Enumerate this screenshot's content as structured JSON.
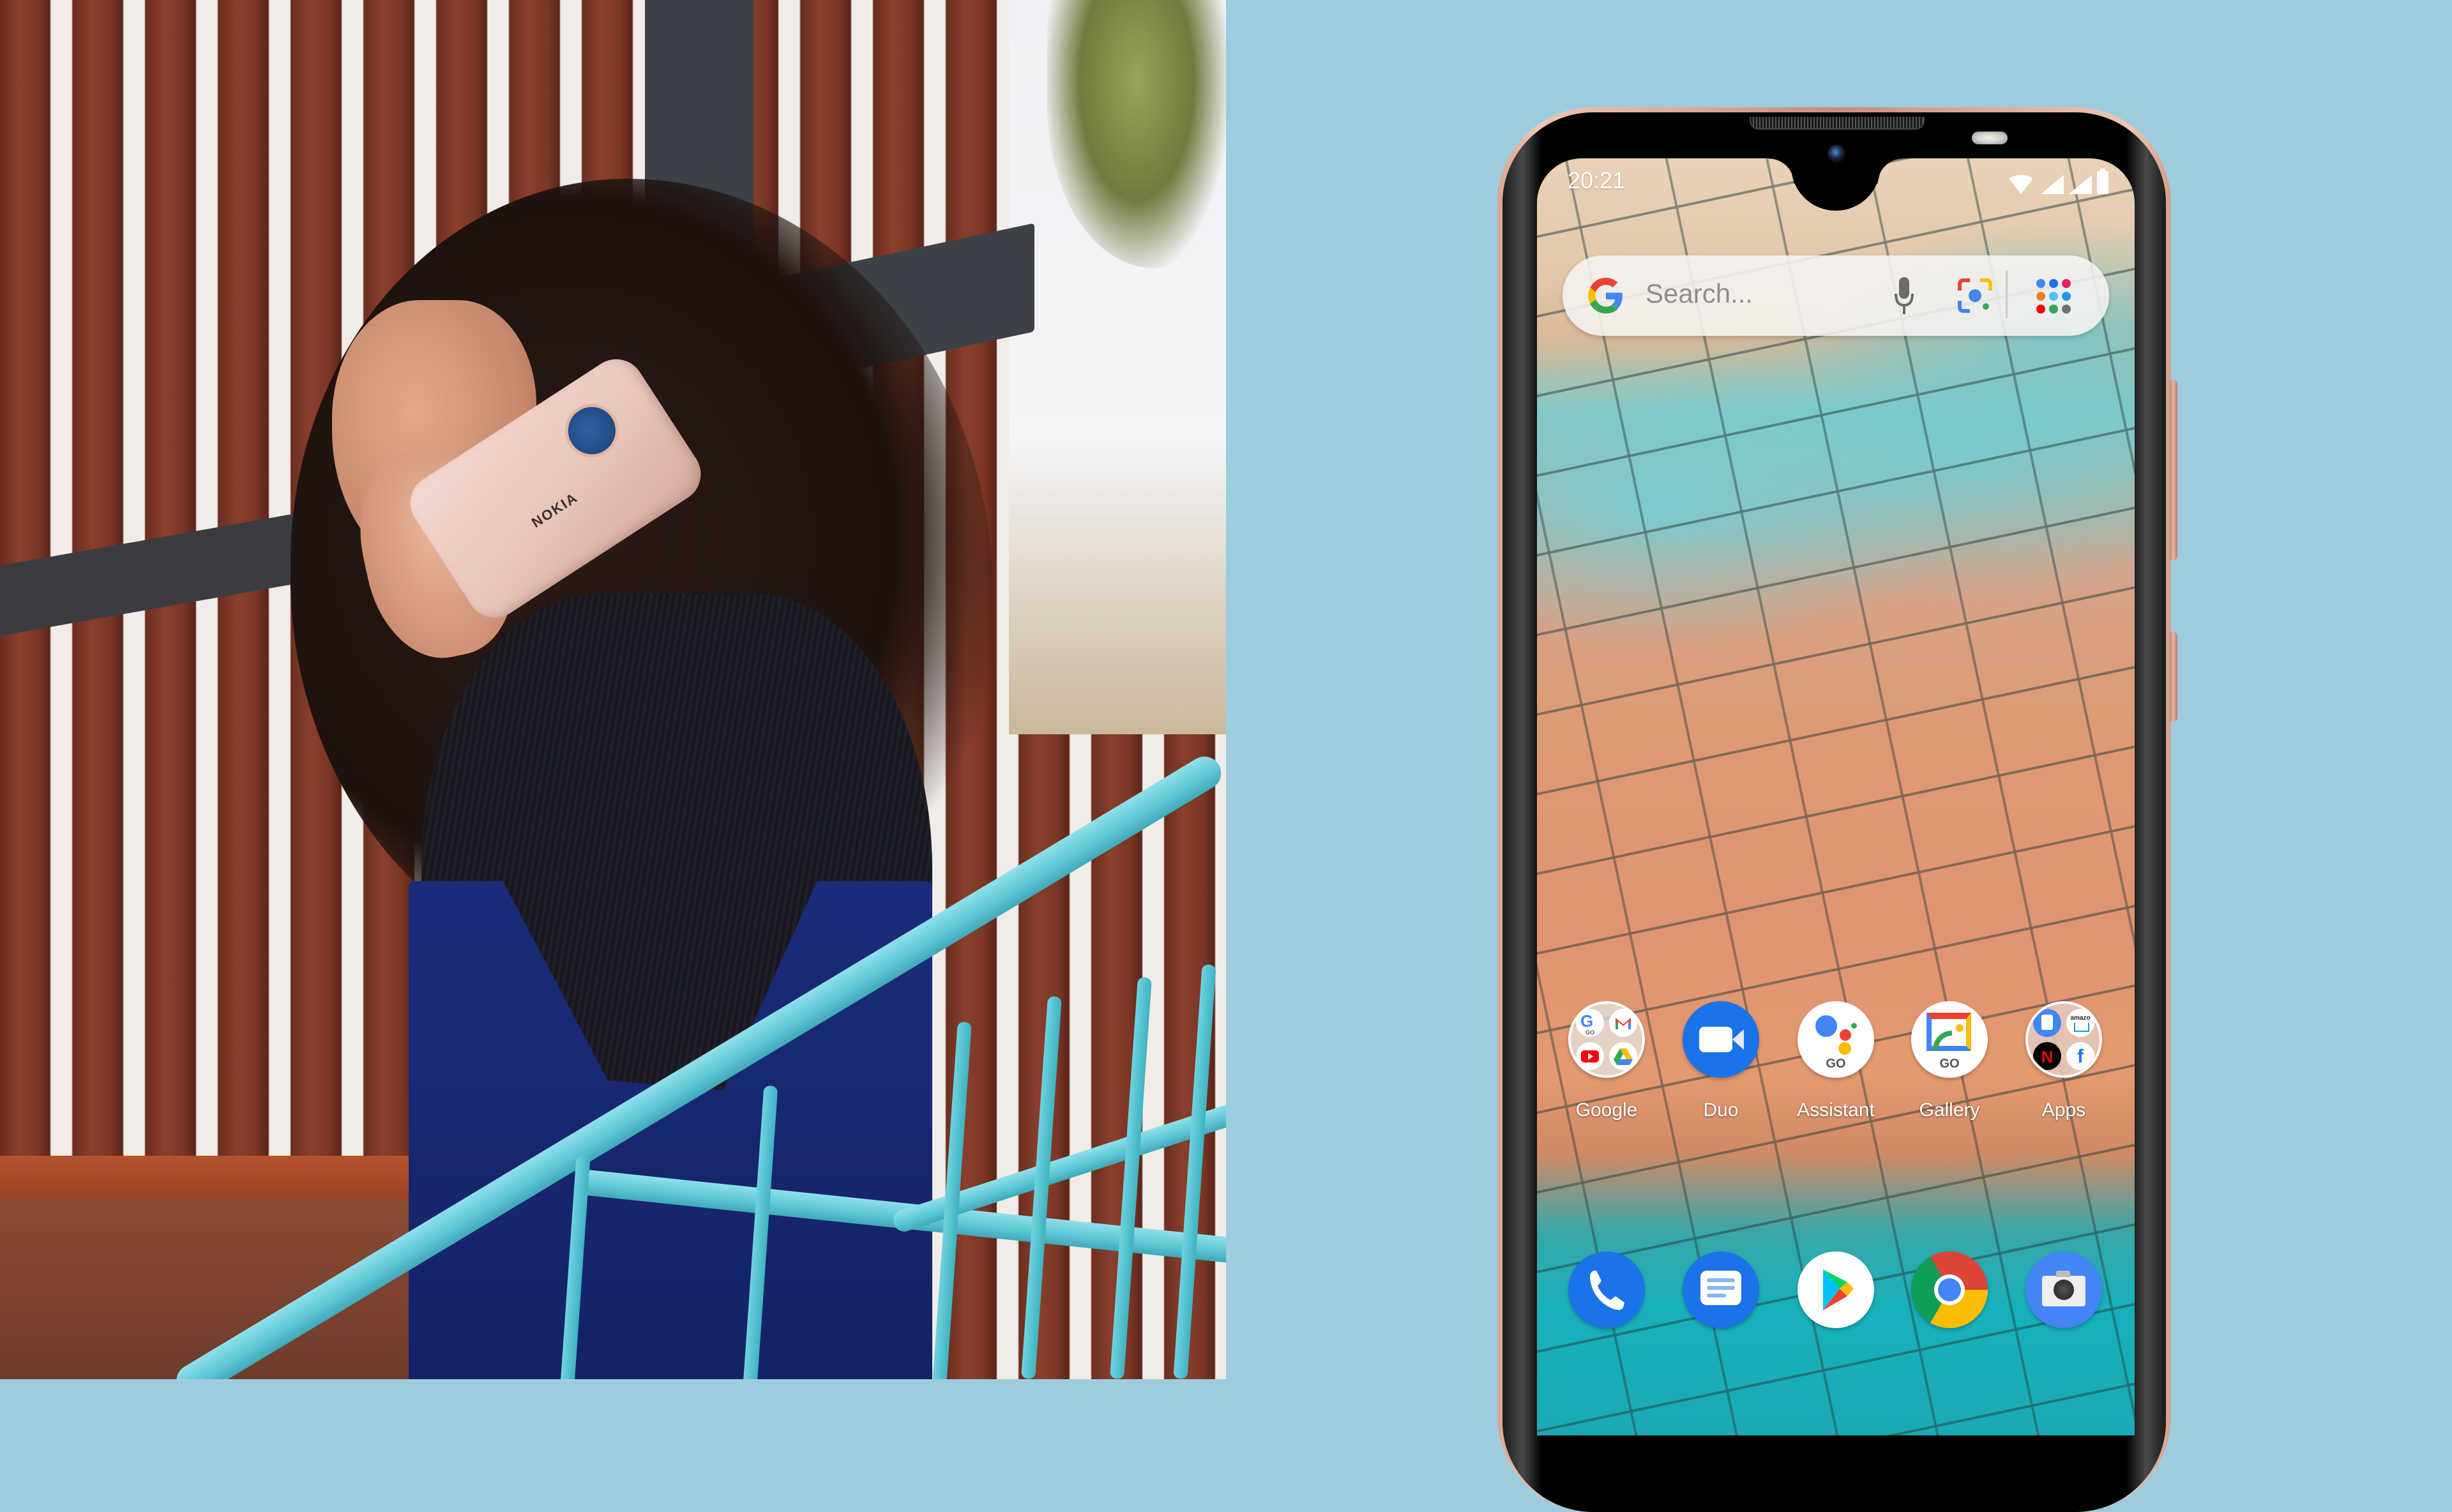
{
  "left_panel": {
    "photo_subject": "woman holding a pink phone to her ear",
    "phone_brand_text": "NOKIA"
  },
  "device": {
    "status_bar": {
      "time": "20:21",
      "icons": [
        "wifi-icon",
        "signal-icon",
        "signal-icon",
        "battery-icon"
      ]
    },
    "search_widget": {
      "placeholder": "Search...",
      "icons": [
        "google-g-icon",
        "microphone-icon",
        "google-lens-icon",
        "apps-grid-icon"
      ]
    },
    "home_apps": [
      {
        "label": "Google",
        "icon": "google-folder-icon",
        "type": "folder",
        "contents": [
          "google-go-icon",
          "gmail-icon",
          "youtube-icon",
          "drive-icon"
        ]
      },
      {
        "label": "Duo",
        "icon": "duo-video-icon"
      },
      {
        "label": "Assistant",
        "icon": "assistant-go-icon",
        "badge": "GO"
      },
      {
        "label": "Gallery",
        "icon": "gallery-go-icon",
        "badge": "GO"
      },
      {
        "label": "Apps",
        "icon": "apps-folder-icon",
        "type": "folder",
        "contents": [
          "files-icon",
          "amazon-icon",
          "netflix-icon",
          "facebook-icon"
        ],
        "amazon_text": "amazo"
      }
    ],
    "dock": [
      {
        "name": "Phone",
        "icon": "phone-icon"
      },
      {
        "name": "Messages",
        "icon": "messages-icon"
      },
      {
        "name": "Play Store",
        "icon": "play-store-icon"
      },
      {
        "name": "Chrome",
        "icon": "chrome-icon"
      },
      {
        "name": "Camera",
        "icon": "camera-icon"
      }
    ]
  },
  "colors": {
    "background": "#9ECCDF",
    "phone_frame": "#E7B6A4",
    "google_blue": "#4285F4",
    "google_red": "#EA4335",
    "google_yellow": "#FBBC05",
    "google_green": "#34A853"
  }
}
